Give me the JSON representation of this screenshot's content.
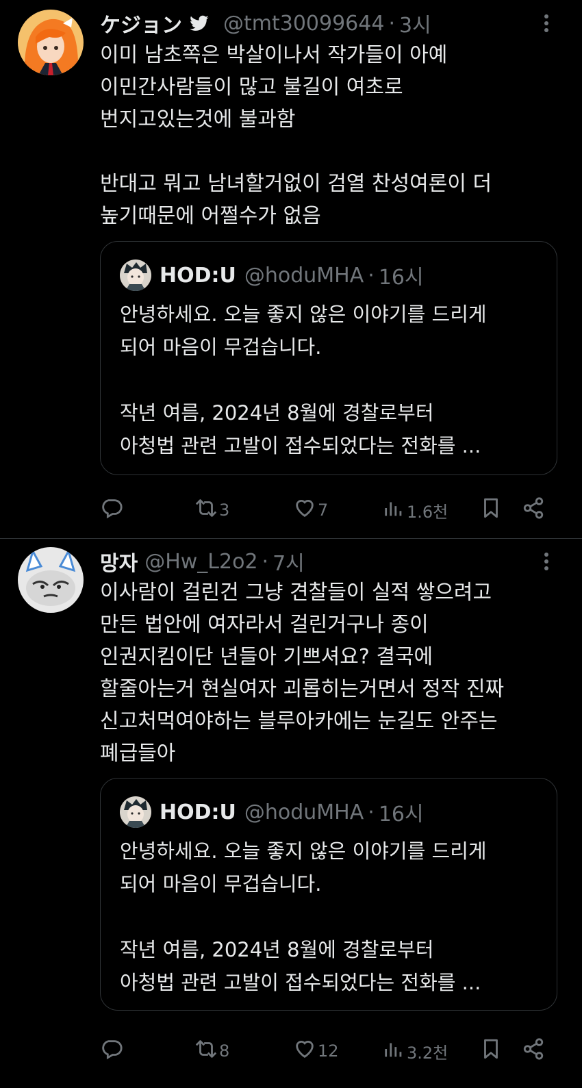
{
  "tweets": [
    {
      "display_name": "ケジョン",
      "handle": "@tmt30099644",
      "separator": "·",
      "time": "3시",
      "text": "이미 남초쪽은 박살이나서 작가들이 아예\n이민간사람들이 많고 불길이 여초로\n번지고있는것에 불과함\n\n반대고 뭐고 남녀할거없이 검열 찬성여론이 더\n높기때문에 어쩔수가 없음",
      "quote": {
        "display_name": "HOD:U",
        "handle": "@hoduMHA",
        "separator": "·",
        "time": "16시",
        "text": "안녕하세요. 오늘 좋지 않은 이야기를 드리게\n되어 마음이 무겁습니다.\n\n작년 여름, 2024년 8월에 경찰로부터\n아청법 관련 고발이 접수되었다는 전화를 ..."
      },
      "actions": {
        "reply_count": "",
        "retweet_count": "3",
        "like_count": "7",
        "views_count": "1.6천"
      }
    },
    {
      "display_name": "망자",
      "handle": "@Hw_L2o2",
      "separator": "·",
      "time": "7시",
      "text": "이사람이 걸린건 그냥 견찰들이 실적 쌓으려고\n만든 법안에 여자라서 걸린거구나 종이\n인권지킴이단 년들아 기쁘셔요? 결국에\n할줄아는거 현실여자 괴롭히는거면서 정작 진짜\n신고처먹여야하는 블루아카에는 눈길도 안주는\n폐급들아",
      "quote": {
        "display_name": "HOD:U",
        "handle": "@hoduMHA",
        "separator": "·",
        "time": "16시",
        "text": "안녕하세요. 오늘 좋지 않은 이야기를 드리게\n되어 마음이 무겁습니다.\n\n작년 여름, 2024년 8월에 경찰로부터\n아청법 관련 고발이 접수되었다는 전화를 ..."
      },
      "actions": {
        "reply_count": "",
        "retweet_count": "8",
        "like_count": "12",
        "views_count": "3.2천"
      }
    }
  ],
  "icons": {
    "verified_badge": "twitter-bird-icon",
    "more": "more-vertical-icon",
    "reply": "reply-icon",
    "retweet": "retweet-icon",
    "like": "heart-icon",
    "views": "views-chart-icon",
    "bookmark": "bookmark-icon",
    "share": "share-icon"
  },
  "colors": {
    "background": "#000000",
    "text_primary": "#e7e9ea",
    "text_secondary": "#71767b",
    "border": "#2f3336",
    "accent_orange": "#f47a22"
  }
}
